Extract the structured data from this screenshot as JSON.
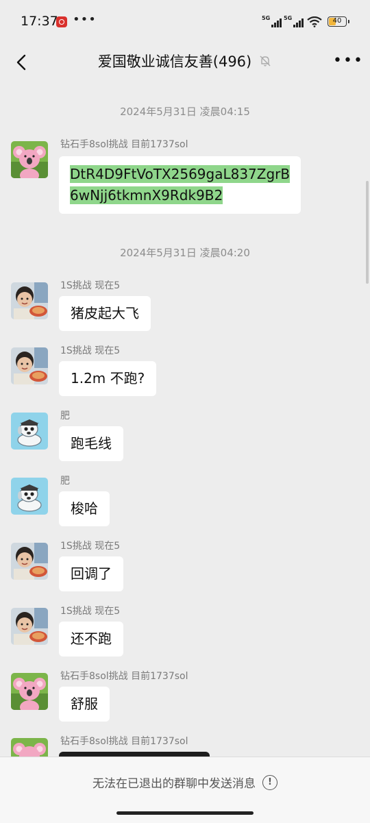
{
  "status_bar": {
    "time": "17:37",
    "dots": "•••",
    "sim1": "5G",
    "sim2": "5G",
    "battery": "40"
  },
  "header": {
    "title": "爱国敬业诚信友善(496)",
    "back_icon": "chevron-left-icon",
    "mute_icon": "bell-off-icon",
    "more": "•••"
  },
  "chat": {
    "messages": [
      {
        "type": "timestamp",
        "text": "2024年5月31日 凌晨04:15"
      },
      {
        "type": "message",
        "sender": "钻石手8sol挑战 目前1737sol",
        "avatar": "koala-avatar",
        "text_line1": "DtR4D9FtVoTX2569gaL837ZgrB",
        "text_line2": "6wNjj6tkmnX9Rdk9B2"
      },
      {
        "type": "timestamp",
        "text": "2024年5月31日 凌晨04:20"
      },
      {
        "type": "message",
        "sender": "1S挑战 现在5",
        "avatar": "boy-avatar",
        "text": "猪皮起大飞"
      },
      {
        "type": "message",
        "sender": "1S挑战 现在5",
        "avatar": "boy-avatar",
        "text": "1.2m 不跑?"
      },
      {
        "type": "message",
        "sender": "肥",
        "avatar": "dog-avatar",
        "text": "跑毛线"
      },
      {
        "type": "message",
        "sender": "肥",
        "avatar": "dog-avatar",
        "text": "梭哈"
      },
      {
        "type": "message",
        "sender": "1S挑战 现在5",
        "avatar": "boy-avatar",
        "text": "回调了"
      },
      {
        "type": "message",
        "sender": "1S挑战 现在5",
        "avatar": "boy-avatar",
        "text": "还不跑"
      },
      {
        "type": "message",
        "sender": "钻石手8sol挑战 目前1737sol",
        "avatar": "koala-avatar",
        "text": "舒服"
      },
      {
        "type": "message",
        "sender": "钻石手8sol挑战 目前1737sol",
        "avatar": "koala-avatar",
        "text": ""
      }
    ]
  },
  "bottom_bar": {
    "notice": "无法在已退出的群聊中发送消息"
  }
}
